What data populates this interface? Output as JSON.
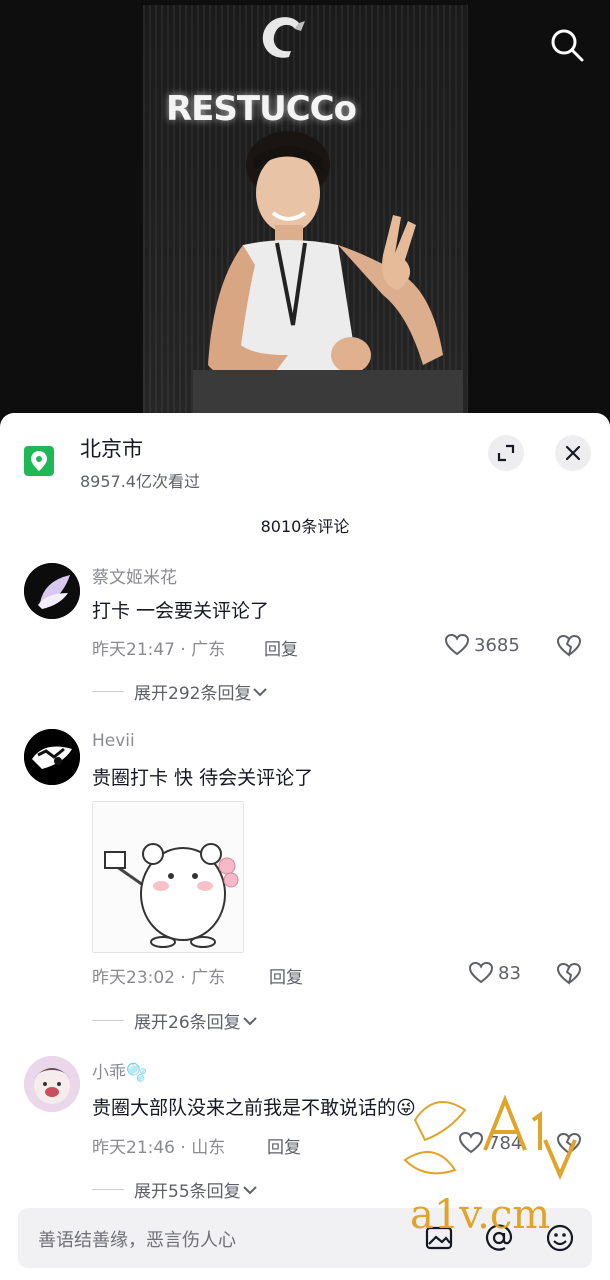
{
  "video": {
    "brand_text": "RESTUCCo"
  },
  "location": {
    "name": "北京市",
    "views": "8957.4亿次看过"
  },
  "comments_count": "8010条评论",
  "comments": [
    {
      "user": "蔡文姬米花",
      "text": "打卡 一会要关评论了",
      "time": "昨天21:47 · 广东",
      "reply": "回复",
      "likes": "3685",
      "expand": "展开292条回复"
    },
    {
      "user": "Hevii",
      "text": "贵圈打卡 快 待会关评论了",
      "time": "昨天23:02 · 广东",
      "reply": "回复",
      "likes": "83",
      "expand": "展开26条回复"
    },
    {
      "user": "小乖🫧",
      "text": "贵圈大部队没来之前我是不敢说话的😜",
      "time": "昨天21:46 · 山东",
      "reply": "回复",
      "likes": "784",
      "expand": "展开55条回复"
    }
  ],
  "input": {
    "placeholder": "善语结善缘，恶言伤人心"
  },
  "watermark": {
    "text": "a1v.cm",
    "logo": "A1V"
  },
  "colors": {
    "location_green": "#1fb857",
    "text_primary": "#161823",
    "text_secondary": "#8a8b91"
  }
}
